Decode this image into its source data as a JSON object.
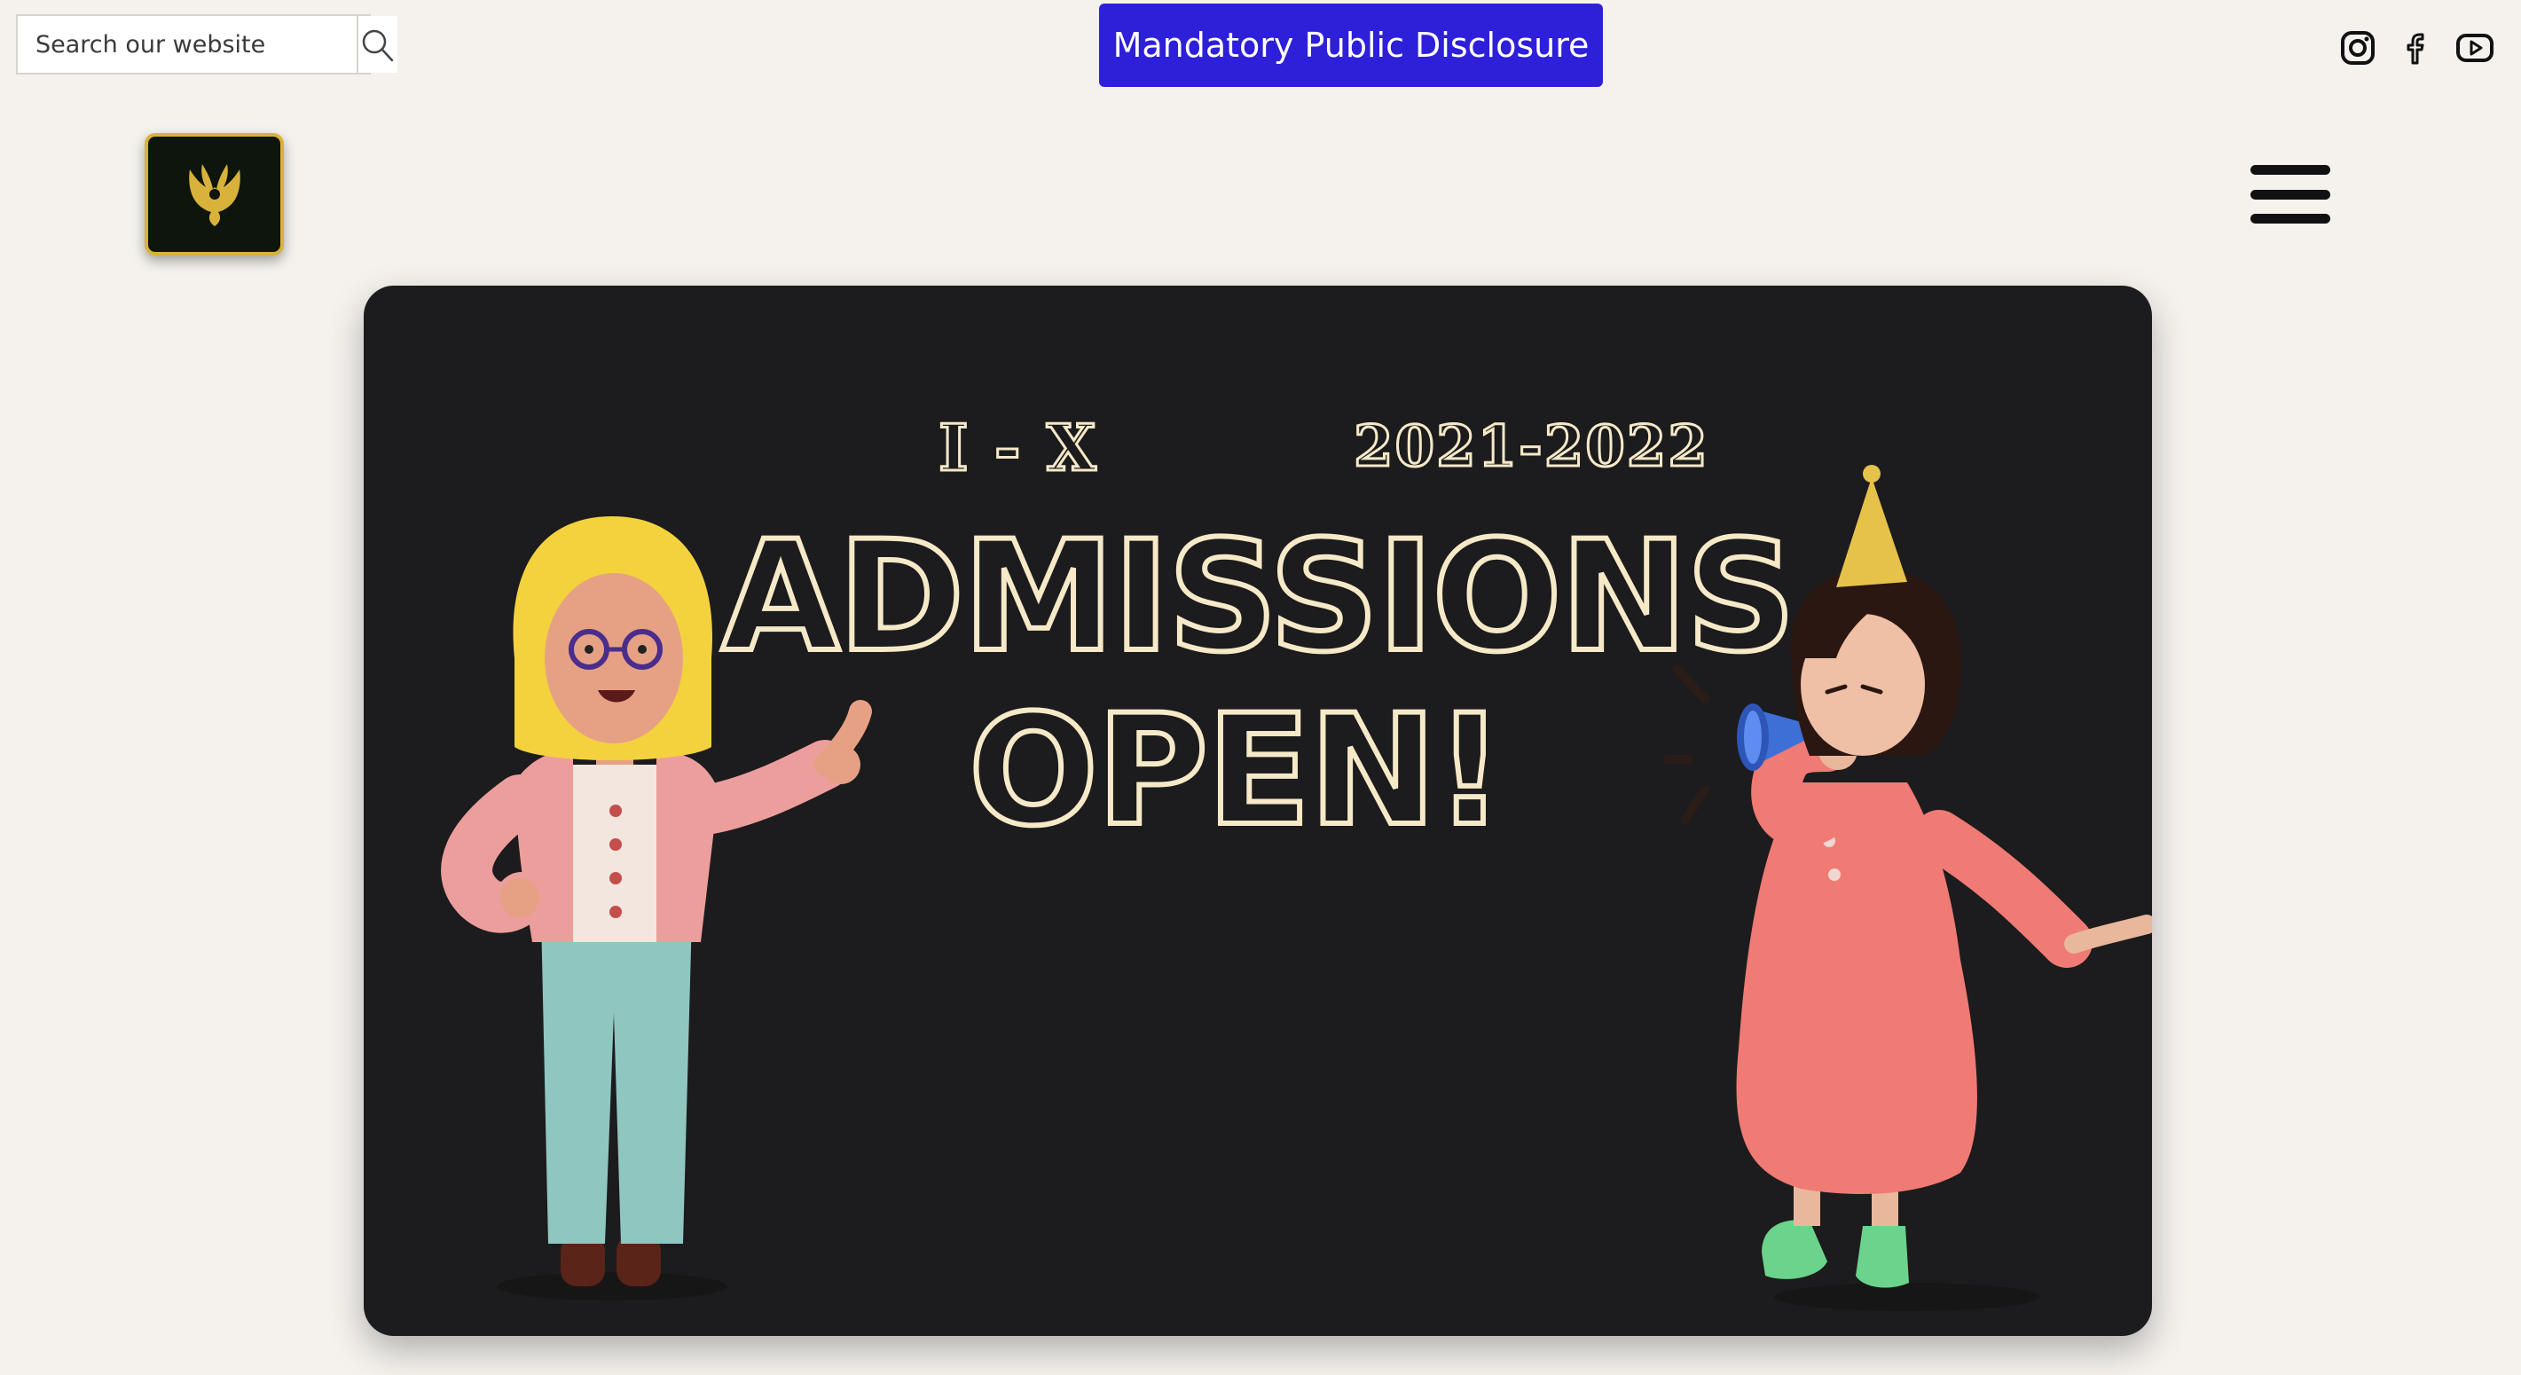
{
  "search": {
    "placeholder": "Search our website",
    "icon": "search-icon"
  },
  "disclosure": {
    "label": "Mandatory Public Disclosure",
    "color": "#2e1fd9"
  },
  "social": [
    {
      "name": "instagram",
      "icon": "instagram-icon"
    },
    {
      "name": "facebook",
      "icon": "facebook-icon"
    },
    {
      "name": "youtube",
      "icon": "youtube-icon"
    }
  ],
  "logo": {
    "icon": "phoenix-icon",
    "accent": "#d8b23a"
  },
  "menu": {
    "icon": "hamburger-icon"
  },
  "hero": {
    "grades": "I - X",
    "year": "2021-2022",
    "line1": "ADMISSIONS",
    "line2": "OPEN!",
    "background": "#1c1b1d",
    "text_color": "#f5e9c8"
  }
}
